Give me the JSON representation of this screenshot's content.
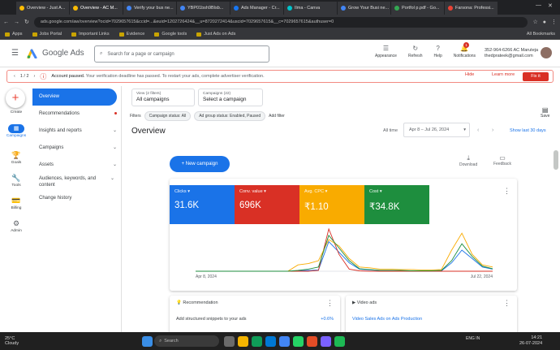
{
  "browser": {
    "tabs": [
      {
        "label": "Overview - Just A...",
        "color": "#fbbc04"
      },
      {
        "label": "Overview - AC M...",
        "color": "#fbbc04",
        "active": true
      },
      {
        "label": "Verify your bus ne...",
        "color": "#4285f4"
      },
      {
        "label": "YBP01bsh9Blsb...",
        "color": "#4285f4"
      },
      {
        "label": "Ads Manager - Cr...",
        "color": "#1877f2"
      },
      {
        "label": "Ilma - Canva",
        "color": "#00c4cc"
      },
      {
        "label": "Grow Your Busi ne...",
        "color": "#4285f4"
      },
      {
        "label": "Portfol p.pdf - Go...",
        "color": "#34a853"
      },
      {
        "label": "Farsona: Professi...",
        "color": "#ea4335"
      }
    ],
    "url": "ads.google.com/aw/overview?ocid=7029657615&ccid=...&euid=1202726424&__u=8720272414&uscid=7029657615&__c=7029657615&authuser=0",
    "bookmarks": [
      "Apps",
      "Jobs Portal",
      "Important Links",
      "Evidence",
      "Google tools",
      "Just Ads on Ads"
    ],
    "all_bookmarks": "All Bookmarks"
  },
  "header": {
    "product": "Google Ads",
    "search_placeholder": "Search for a page or campaign",
    "icons": [
      {
        "label": "Appearance",
        "icon": "appearance-icon",
        "glyph": "☰"
      },
      {
        "label": "Refresh",
        "icon": "refresh-icon",
        "glyph": "↻"
      },
      {
        "label": "Help",
        "icon": "help-icon",
        "glyph": "?"
      },
      {
        "label": "Notifications",
        "icon": "bell-icon",
        "glyph": "🔔"
      }
    ],
    "notification_count": "1",
    "account_id": "352-964-6266 AC Maruteja",
    "account_email": "thedprateek@gmail.com"
  },
  "banner": {
    "pager": "1 / 2",
    "message_bold": "Account paused.",
    "message": " Your verification deadline has passed. To restart your ads, complete advertiser verification.",
    "hide_label": "Hide",
    "learn_more_label": "Learn more",
    "fix_label": "Fix it"
  },
  "rail": {
    "create": "Create",
    "items": [
      {
        "label": "Campaigns",
        "icon": "campaigns-icon"
      },
      {
        "label": "Goals",
        "icon": "goals-icon",
        "glyph": "🏆"
      },
      {
        "label": "Tools",
        "icon": "tools-icon",
        "glyph": "🔧"
      },
      {
        "label": "Billing",
        "icon": "billing-icon",
        "glyph": "💳"
      },
      {
        "label": "Admin",
        "icon": "admin-icon",
        "glyph": "⚙"
      }
    ]
  },
  "nav": {
    "items": [
      {
        "label": "Overview",
        "active": true
      },
      {
        "label": "Recommendations",
        "dot": true
      },
      {
        "label": "Insights and reports",
        "chevron": true
      },
      {
        "label": "Campaigns",
        "chevron": true
      },
      {
        "label": "Assets",
        "chevron": true
      },
      {
        "label": "Audiences, keywords, and content",
        "chevron": true
      },
      {
        "label": "Change history"
      }
    ]
  },
  "main": {
    "view_label": "View (2 filters)",
    "view_value": "All campaigns",
    "campaigns_label": "Campaigns (22)",
    "campaigns_value": "Select a campaign",
    "filters_label": "Filters",
    "chips": [
      "Campaign status: All",
      "Ad group status: Enabled, Paused"
    ],
    "add_filter": "Add filter",
    "save": "Save",
    "title": "Overview",
    "all_time": "All time",
    "date_range": "Apr 8 – Jul 26, 2024",
    "show_last": "Show last 30 days",
    "new_campaign": "New campaign",
    "download": "Download",
    "feedback": "Feedback"
  },
  "metrics": [
    {
      "label": "Clicks",
      "value": "31.6K",
      "color": "#1a73e8"
    },
    {
      "label": "Conv. value",
      "value": "696K",
      "color": "#d93025"
    },
    {
      "label": "Avg. CPC",
      "value": "₹1.10",
      "color": "#f9ab00"
    },
    {
      "label": "Cost",
      "value": "₹34.8K",
      "color": "#1e8e3e"
    }
  ],
  "chart_data": {
    "type": "line",
    "x_start_label": "Apr 8, 2024",
    "x_end_label": "Jul 22, 2024",
    "series": [
      {
        "color": "#1a73e8",
        "values": [
          0,
          0,
          0,
          0,
          0,
          0,
          0,
          0,
          0,
          0,
          1,
          2,
          3,
          70,
          45,
          20,
          5,
          3,
          2,
          2,
          1,
          1,
          1,
          1,
          1,
          20,
          50,
          30,
          10,
          5
        ]
      },
      {
        "color": "#d93025",
        "values": [
          0,
          0,
          0,
          0,
          0,
          0,
          0,
          0,
          0,
          0,
          0,
          0,
          2,
          100,
          40,
          5,
          1,
          0,
          0,
          0,
          0,
          0,
          0,
          0,
          0,
          0,
          0,
          0,
          0,
          0
        ]
      },
      {
        "color": "#f9ab00",
        "values": [
          0,
          0,
          0,
          0,
          0,
          0,
          0,
          0,
          0,
          0,
          15,
          18,
          25,
          75,
          60,
          30,
          10,
          8,
          5,
          5,
          4,
          4,
          3,
          3,
          4,
          50,
          90,
          40,
          15,
          10
        ]
      },
      {
        "color": "#1e8e3e",
        "values": [
          0,
          0,
          0,
          0,
          0,
          0,
          0,
          0,
          0,
          0,
          2,
          5,
          10,
          85,
          55,
          25,
          6,
          4,
          2,
          2,
          2,
          1,
          1,
          1,
          2,
          25,
          65,
          35,
          12,
          6
        ]
      }
    ]
  },
  "cards": {
    "recommendation_title": "Recommendation",
    "recommendation_item": "Add structured snippets to your ads",
    "recommendation_pct": "+0.6%",
    "video_title": "Video ads",
    "video_item": "Video Sales Ads on Ads Production"
  },
  "taskbar": {
    "weather_temp": "25°C",
    "weather_desc": "Cloudy",
    "search_placeholder": "Search",
    "lang": "ENG IN",
    "time": "14:21",
    "date": "26-07-2024"
  }
}
